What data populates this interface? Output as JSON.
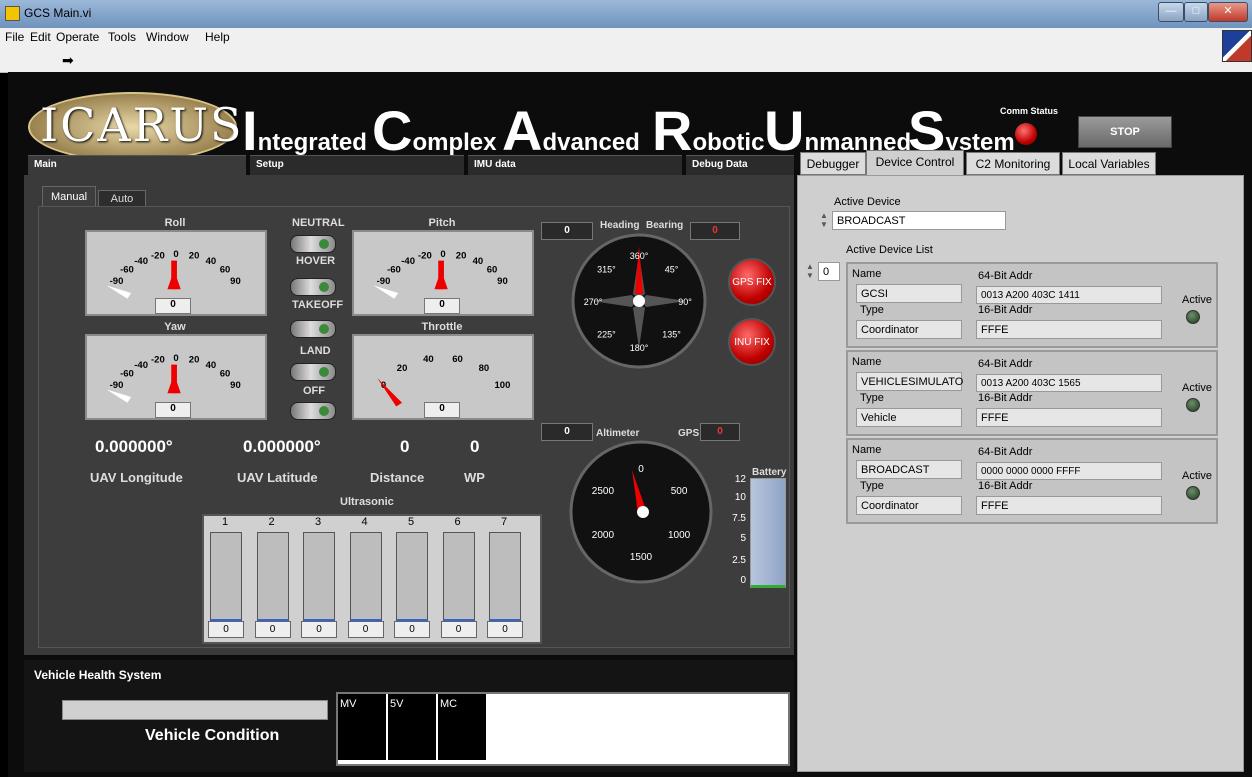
{
  "window": {
    "title": "GCS Main.vi"
  },
  "menu": [
    "File",
    "Edit",
    "Operate",
    "Tools",
    "Window",
    "Help"
  ],
  "banner": {
    "logo": "ICARUS",
    "words": [
      {
        "cap": "I",
        "rest": "ntegrated"
      },
      {
        "cap": "C",
        "rest": "omplex"
      },
      {
        "cap": "A",
        "rest": "dvanced"
      },
      {
        "cap": "R",
        "rest": "obotic"
      },
      {
        "cap": "U",
        "rest": "nmanned"
      },
      {
        "cap": "S",
        "rest": "ystem"
      }
    ],
    "comm_status": "Comm Status",
    "stop": "STOP"
  },
  "main_tabs": [
    "Main",
    "Setup",
    "IMU data",
    "Debug Data"
  ],
  "mode_tabs": [
    "Manual",
    "Auto"
  ],
  "gauges": {
    "roll": {
      "label": "Roll",
      "value": "0",
      "ticks": [
        "-90",
        "-60",
        "-40",
        "-20",
        "0",
        "20",
        "40",
        "60",
        "90"
      ]
    },
    "pitch": {
      "label": "Pitch",
      "value": "0",
      "ticks": [
        "-90",
        "-60",
        "-40",
        "-20",
        "0",
        "20",
        "40",
        "60",
        "90"
      ]
    },
    "yaw": {
      "label": "Yaw",
      "value": "0",
      "ticks": [
        "-90",
        "-60",
        "-40",
        "-20",
        "0",
        "20",
        "40",
        "60",
        "90"
      ]
    },
    "throttle": {
      "label": "Throttle",
      "value": "0",
      "ticks": [
        "0",
        "20",
        "40",
        "60",
        "80",
        "100"
      ]
    }
  },
  "states": [
    "NEUTRAL",
    "HOVER",
    "TAKEOFF",
    "LAND",
    "OFF"
  ],
  "compass": {
    "heading_label": "Heading",
    "bearing_label": "Bearing",
    "heading_value": "0",
    "bearing_value": "0",
    "ticks": [
      "360°",
      "45°",
      "90°",
      "135°",
      "180°",
      "225°",
      "270°",
      "315°"
    ]
  },
  "fix": {
    "gps": "GPS FIX",
    "inu": "INU FIX"
  },
  "altimeter": {
    "label": "Altimeter",
    "value": "0",
    "gps_label": "GPS",
    "gps_value": "0",
    "ticks": [
      "0",
      "500",
      "1000",
      "1500",
      "2000",
      "2500"
    ]
  },
  "battery": {
    "label": "Battery",
    "ticks": [
      "12",
      "10",
      "7.5",
      "5",
      "2.5",
      "0"
    ]
  },
  "readouts": [
    {
      "value": "0.000000°",
      "label": "UAV Longitude"
    },
    {
      "value": "0.000000°",
      "label": "UAV Latitude"
    },
    {
      "value": "0",
      "label": "Distance"
    },
    {
      "value": "0",
      "label": "WP"
    }
  ],
  "ultrasonic": {
    "label": "Ultrasonic",
    "channels": [
      "1",
      "2",
      "3",
      "4",
      "5",
      "6",
      "7"
    ],
    "values": [
      "0",
      "0",
      "0",
      "0",
      "0",
      "0",
      "0"
    ]
  },
  "health": {
    "title": "Vehicle Health System",
    "condition": "Vehicle Condition",
    "channels": [
      "MV",
      "5V",
      "MC"
    ]
  },
  "right_tabs": [
    "Debugger",
    "Device Control",
    "C2 Monitoring",
    "Local Variables"
  ],
  "device": {
    "active_label": "Active Device",
    "active_value": "BROADCAST",
    "list_label": "Active Device List",
    "index": "0",
    "field_labels": {
      "name": "Name",
      "addr64": "64-Bit Addr",
      "type": "Type",
      "addr16": "16-Bit Addr",
      "active": "Active"
    },
    "devices": [
      {
        "name": "GCSI",
        "addr64": "0013 A200 403C 1411",
        "type": "Coordinator",
        "addr16": "FFFE"
      },
      {
        "name": "VEHICLESIMULATO",
        "addr64": "0013 A200 403C 1565",
        "type": "Vehicle",
        "addr16": "FFFE"
      },
      {
        "name": "BROADCAST",
        "addr64": "0000 0000 0000 FFFF",
        "type": "Coordinator",
        "addr16": "FFFE"
      }
    ]
  }
}
